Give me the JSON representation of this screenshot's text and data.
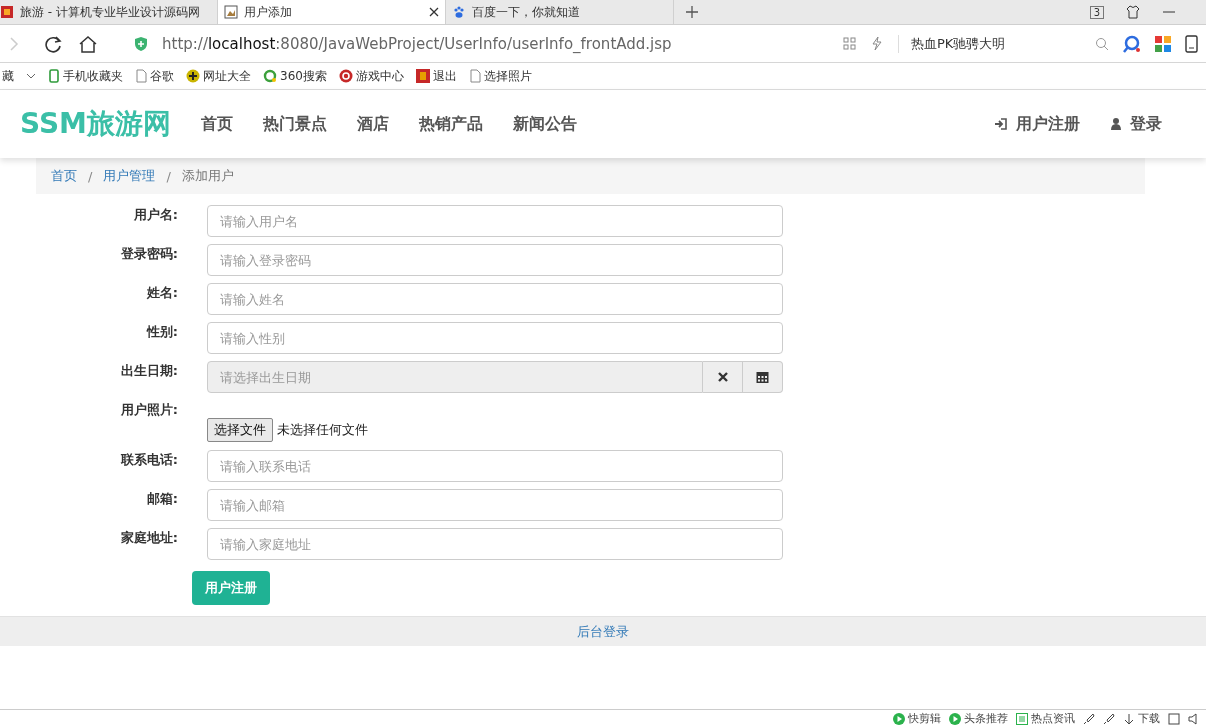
{
  "browser": {
    "tabs": [
      {
        "title": "旅游 - 计算机专业毕业设计源码网",
        "selected": false
      },
      {
        "title": "用户添加",
        "selected": true
      },
      {
        "title": "百度一下，你就知道",
        "selected": false
      }
    ],
    "tab_count": "3",
    "url_scheme": "http://",
    "url_host": "localhost",
    "url_rest": ":8080/JavaWebProject/UserInfo/userInfo_frontAdd.jsp",
    "search_text": "热血PK驰骋大明",
    "bookmarks": [
      "藏",
      "手机收藏夹",
      "谷歌",
      "网址大全",
      "360搜索",
      "游戏中心",
      "退出",
      "选择照片"
    ]
  },
  "navbar": {
    "brand": "SSM旅游网",
    "items": [
      "首页",
      "热门景点",
      "酒店",
      "热销产品",
      "新闻公告"
    ],
    "register": "用户注册",
    "login": "登录"
  },
  "breadcrumb": {
    "separator": "/",
    "items": [
      {
        "label": "首页",
        "link": true
      },
      {
        "label": "用户管理",
        "link": true
      },
      {
        "label": "添加用户",
        "link": false
      }
    ]
  },
  "form": {
    "fields": [
      {
        "kind": "text",
        "label": "用户名:",
        "placeholder": "请输入用户名"
      },
      {
        "kind": "text",
        "label": "登录密码:",
        "placeholder": "请输入登录密码"
      },
      {
        "kind": "text",
        "label": "姓名:",
        "placeholder": "请输入姓名"
      },
      {
        "kind": "text",
        "label": "性别:",
        "placeholder": "请输入性别"
      },
      {
        "kind": "date",
        "label": "出生日期:",
        "placeholder": "请选择出生日期"
      },
      {
        "kind": "file",
        "label": "用户照片:",
        "button": "选择文件",
        "status": "未选择任何文件"
      },
      {
        "kind": "text",
        "label": "联系电话:",
        "placeholder": "请输入联系电话"
      },
      {
        "kind": "text",
        "label": "邮箱:",
        "placeholder": "请输入邮箱"
      },
      {
        "kind": "text",
        "label": "家庭地址:",
        "placeholder": "请输入家庭地址"
      }
    ],
    "submit": "用户注册"
  },
  "footer": {
    "link": "后台登录"
  },
  "status_bar": {
    "items": [
      "快剪辑",
      "头条推荐",
      "热点资讯",
      "下载"
    ]
  }
}
